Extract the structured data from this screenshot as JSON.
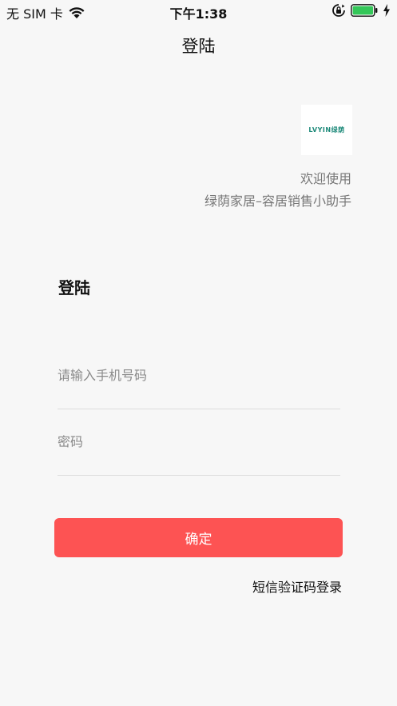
{
  "status_bar": {
    "carrier": "无 SIM 卡",
    "time": "下午1:38",
    "icons": [
      "wifi-icon",
      "rotation-lock-icon",
      "battery-icon",
      "charging-icon"
    ],
    "battery_color": "#34c759"
  },
  "nav": {
    "title": "登陆"
  },
  "logo": {
    "text": "LVYIN绿荫"
  },
  "welcome": {
    "line1": "欢迎使用",
    "line2": "绿荫家居–容居销售小助手"
  },
  "form": {
    "title": "登陆",
    "phone_placeholder": "请输入手机号码",
    "phone_value": "",
    "password_placeholder": "密码",
    "password_value": "",
    "confirm_label": "确定",
    "sms_login_label": "短信验证码登录"
  },
  "colors": {
    "accent": "#fd5353",
    "background": "#f7f7f7",
    "logo_green": "#1e8a7a"
  }
}
